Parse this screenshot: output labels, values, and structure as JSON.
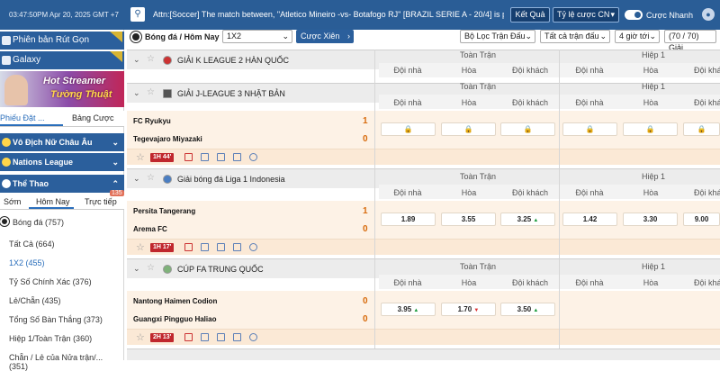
{
  "topbar": {
    "clock": "03:47:50PM Apr 20, 2025 GMT +7",
    "ticker": "Attn:[Soccer] The match between, \"Atletico Mineiro -vs- Botafogo RJ\" [BRAZIL SERIE A - 20/4] is playing",
    "ketqua": "Kết Quả",
    "odds_type": "Tỷ lệ cược CN",
    "fast_label": "Cược Nhanh",
    "colors": {
      "primary": "#2a5d96",
      "dark": "#163f70"
    }
  },
  "sidebar": {
    "version_btn": "Phiên bản Rút Gọn",
    "galaxy_btn": "Galaxy",
    "banner_line1": "Hot Streamer",
    "banner_line2": "Tường Thuật",
    "tab_slip": "Phiếu Đặt ...",
    "tab_table": "Bảng Cược",
    "cat1": "Vô Địch Nữ Châu Âu",
    "cat2": "Nations League",
    "cat3": "Thể Thao",
    "subtab_early": "Sớm",
    "subtab_today": "Hôm Nay",
    "subtab_live": "Trực tiếp",
    "live_count": "135",
    "sport": "Bóng đá",
    "sport_count": "(757)",
    "items": [
      {
        "label": "Tất Cả",
        "count": "(664)"
      },
      {
        "label": "1X2",
        "count": "(455)"
      },
      {
        "label": "Tỷ Số Chính Xác",
        "count": "(376)"
      },
      {
        "label": "Lẻ/Chẵn",
        "count": "(435)"
      },
      {
        "label": "Tổng Số Bàn Thắng",
        "count": "(373)"
      },
      {
        "label": "Hiệp 1/Toàn Trận",
        "count": "(360)"
      },
      {
        "label": "Chẵn / Lẻ của Nửa trận/...",
        "count": "(351)"
      }
    ]
  },
  "filters": {
    "breadcrumb": "Bóng đá / Hôm Nay",
    "market": "1X2",
    "parlay": "Cược Xiên",
    "league_filter": "Bộ Lọc Trận Đấu",
    "all_matches": "Tất cả trận đấu",
    "time": "4 giờ tới",
    "count": "(70 / 70) Giải"
  },
  "headers": {
    "full": "Toàn Trận",
    "half": "Hiệp 1",
    "home": "Đội nhà",
    "draw": "Hòa",
    "away": "Đội khách"
  },
  "leagues": [
    {
      "name": "GIẢI K LEAGUE 2 HÀN QUỐC"
    },
    {
      "name": "GIẢI J-LEAGUE 3 NHẬT BẢN"
    },
    {
      "name": "Giải bóng đá Liga 1 Indonesia"
    },
    {
      "name": "CÚP FA TRUNG QUỐC"
    }
  ],
  "matches": [
    {
      "home": "FC Ryukyu",
      "away": "Tegevajaro Miyazaki",
      "home_score": "1",
      "away_score": "0",
      "live": "1H 44'",
      "odds": [
        "",
        "",
        "",
        "",
        "",
        ""
      ]
    },
    {
      "home": "Persita Tangerang",
      "away": "Arema FC",
      "home_score": "1",
      "away_score": "0",
      "live": "1H 17'",
      "odds": [
        "1.89",
        "3.55",
        "3.25",
        "1.42",
        "3.30",
        "9.00"
      ]
    },
    {
      "home": "Nantong Haimen Codion",
      "away": "Guangxi Pingguo Haliao",
      "home_score": "0",
      "away_score": "0",
      "live": "2H 13'",
      "odds": [
        "3.95",
        "1.70",
        "3.50"
      ]
    }
  ]
}
